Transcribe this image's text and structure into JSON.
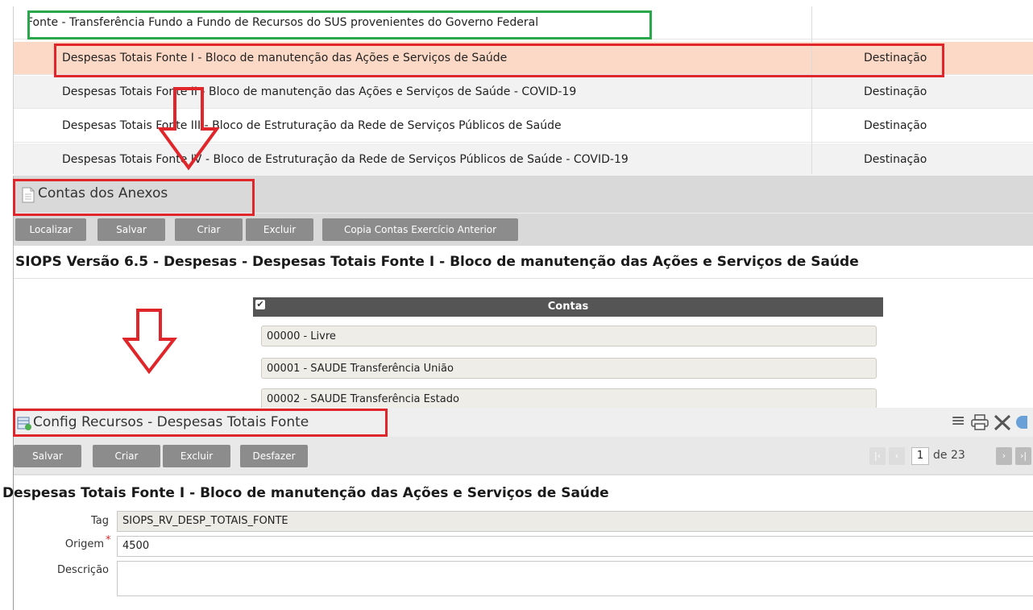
{
  "fonte_table": {
    "header": "Fonte - Transferência Fundo a Fundo de Recursos do SUS provenientes do Governo Federal",
    "rows": [
      {
        "name": "Despesas Totais Fonte I - Bloco de manutenção das Ações e Serviços de Saúde",
        "type": "Destinação"
      },
      {
        "name": "Despesas Totais Fonte II - Bloco de manutenção das Ações e Serviços de Saúde - COVID-19",
        "type": "Destinação"
      },
      {
        "name": "Despesas Totais Fonte III - Bloco de Estruturação da Rede de Serviços Públicos de Saúde",
        "type": "Destinação"
      },
      {
        "name": "Despesas Totais Fonte IV - Bloco de Estruturação da Rede de Serviços Públicos de Saúde - COVID-19",
        "type": "Destinação"
      }
    ]
  },
  "contas_panel": {
    "title": "Contas dos Anexos",
    "buttons": [
      "Localizar",
      "Salvar",
      "Criar",
      "Excluir",
      "Copia Contas Exercício Anterior"
    ],
    "heading": "SIOPS Versão 6.5 - Despesas - Despesas Totais Fonte I - Bloco de manutenção das Ações e Serviços de Saúde",
    "contas_header": "Contas",
    "contas": [
      "00000 - Livre",
      "00001 - SAUDE Transferência União",
      "00002 - SAUDE Transferência Estado"
    ]
  },
  "config_panel": {
    "title": "Config Recursos - Despesas Totais Fonte",
    "buttons": [
      "Salvar",
      "Criar",
      "Excluir",
      "Desfazer"
    ],
    "pager": {
      "current": "1",
      "of_label": "de 23"
    },
    "heading": "Despesas Totais Fonte I - Bloco de manutenção das Ações e Serviços de Saúde",
    "fields": {
      "tag_label": "Tag",
      "tag_value": "SIOPS_RV_DESP_TOTAIS_FONTE",
      "origem_label": "Origem",
      "origem_value": "4500",
      "descricao_label": "Descrição",
      "descricao_value": ""
    }
  },
  "colors": {
    "highlight_row": "#fcd9c6",
    "annotation_red": "#e0262a",
    "annotation_green": "#28a74b",
    "button_gray": "#8c8c8c"
  }
}
